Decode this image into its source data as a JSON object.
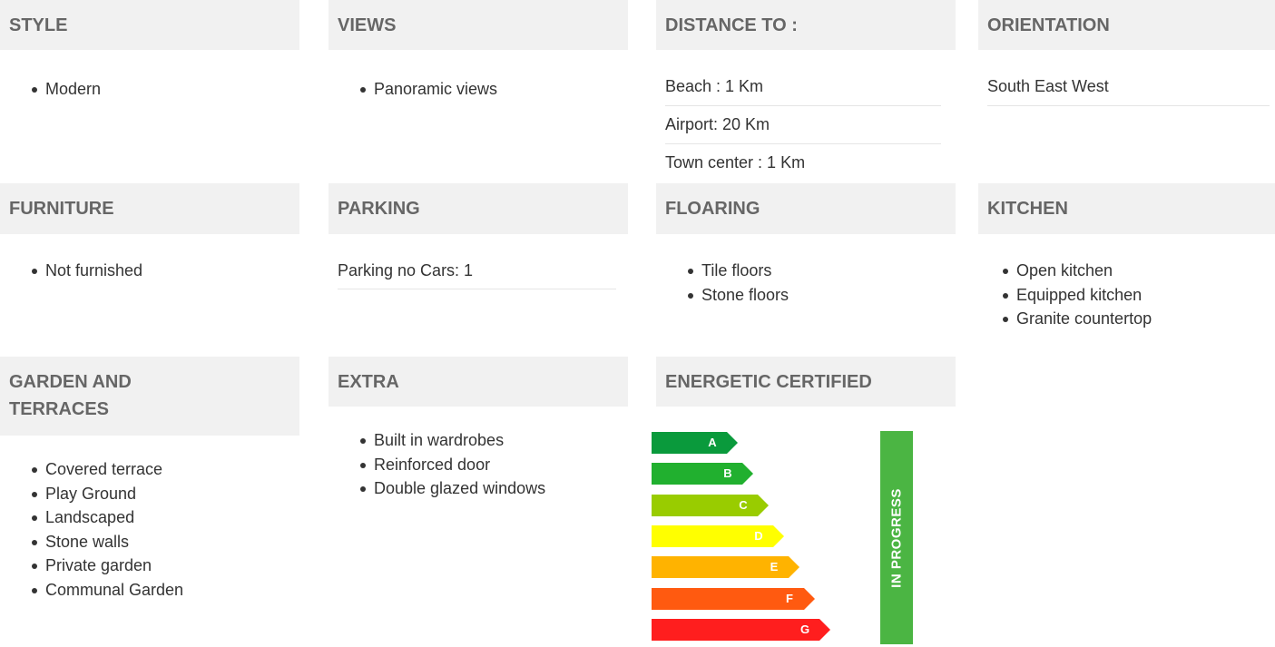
{
  "sections": {
    "style": {
      "title": "STYLE",
      "items": [
        "Modern"
      ]
    },
    "views": {
      "title": "VIEWS",
      "items": [
        "Panoramic views"
      ]
    },
    "distance": {
      "title": "DISTANCE TO :",
      "rows": [
        "Beach : 1 Km",
        "Airport: 20 Km",
        "Town center : 1 Km"
      ]
    },
    "orientation": {
      "title": "ORIENTATION",
      "rows": [
        "South East West"
      ]
    },
    "furniture": {
      "title": "FURNITURE",
      "items": [
        "Not furnished"
      ]
    },
    "parking": {
      "title": "PARKING",
      "rows": [
        "Parking no Cars: 1"
      ]
    },
    "flooring": {
      "title": "FLOARING",
      "items": [
        "Tile floors",
        "Stone floors"
      ]
    },
    "kitchen": {
      "title": "KITCHEN",
      "items": [
        "Open kitchen",
        "Equipped kitchen",
        "Granite countertop"
      ]
    },
    "garden": {
      "title_line1": "GARDEN AND",
      "title_line2": "TERRACES",
      "items": [
        "Covered terrace",
        "Play Ground",
        "Landscaped",
        "Stone walls",
        "Private garden",
        "Communal Garden"
      ]
    },
    "extra": {
      "title": "EXTRA",
      "items": [
        "Built in wardrobes",
        "Reinforced door",
        "Double glazed windows"
      ]
    },
    "energy": {
      "title": "ENERGETIC CERTIFIED",
      "status": "IN PROGRESS",
      "status_color": "#4bb543",
      "classes": [
        {
          "letter": "A",
          "color": "#0a9a3c"
        },
        {
          "letter": "B",
          "color": "#21b02f"
        },
        {
          "letter": "C",
          "color": "#99cc00"
        },
        {
          "letter": "D",
          "color": "#ffff00"
        },
        {
          "letter": "E",
          "color": "#ffb300"
        },
        {
          "letter": "F",
          "color": "#ff5a10"
        },
        {
          "letter": "G",
          "color": "#ff1e1e"
        }
      ]
    }
  }
}
